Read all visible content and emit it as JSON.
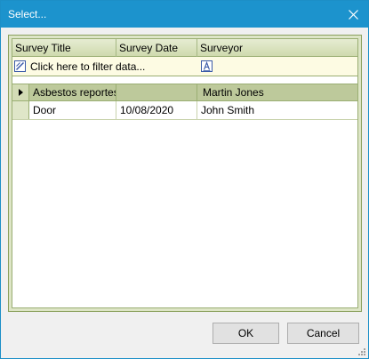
{
  "window": {
    "title": "Select..."
  },
  "grid": {
    "columns": [
      "Survey Title",
      "Survey Date",
      "Surveyor"
    ],
    "filter_prompt": "Click here to filter data...",
    "group": {
      "title": "Asbestos reportes",
      "date": "",
      "surveyor": "Martin Jones"
    },
    "rows": [
      {
        "title": "Door",
        "date": "10/08/2020",
        "surveyor": "John Smith"
      }
    ]
  },
  "buttons": {
    "ok": "OK",
    "cancel": "Cancel"
  },
  "colors": {
    "titlebar": "#1c93cd",
    "grid_header": "#cfdaae",
    "filter_row": "#fdfbe3",
    "group_row": "#bdc99b"
  },
  "icons": {
    "close": "close-icon",
    "filter_edit": "filter-edit-icon",
    "filter_text": "text-filter-icon",
    "row_pointer": "row-pointer-icon"
  }
}
